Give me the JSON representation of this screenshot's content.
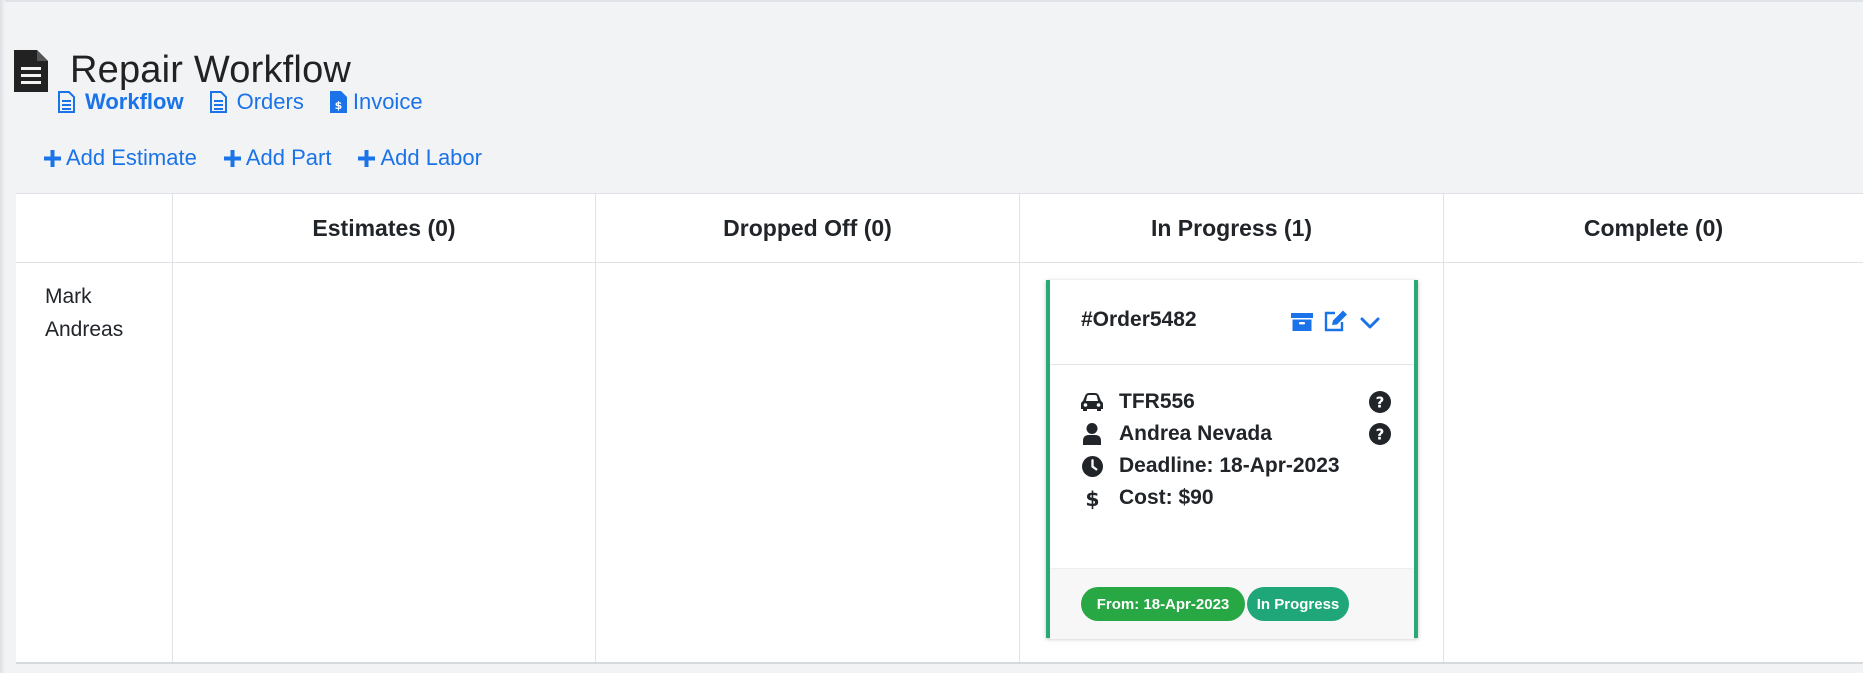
{
  "page": {
    "title": "Repair Workflow",
    "title_icon": "document-icon"
  },
  "nav": {
    "items": [
      {
        "label": "Workflow",
        "icon": "document-icon",
        "active": true
      },
      {
        "label": "Orders",
        "icon": "document-icon",
        "active": false
      },
      {
        "label": "Invoice",
        "icon": "invoice-icon",
        "active": false
      }
    ]
  },
  "actions": [
    {
      "label": "Add Estimate",
      "icon": "plus-icon"
    },
    {
      "label": "Add Part",
      "icon": "plus-icon"
    },
    {
      "label": "Add Labor",
      "icon": "plus-icon"
    }
  ],
  "board": {
    "columns": [
      {
        "label": "Estimates (0)"
      },
      {
        "label": "Dropped Off (0)"
      },
      {
        "label": "In Progress (1)"
      },
      {
        "label": "Complete (0)"
      }
    ],
    "rows": [
      {
        "label": "Mark Andreas"
      }
    ]
  },
  "card": {
    "order_id": "#Order5482",
    "header_icons": [
      "archive-icon",
      "edit-icon",
      "chevron-down-icon"
    ],
    "details": [
      {
        "icon": "car-icon",
        "text": "TFR556",
        "help": true
      },
      {
        "icon": "user-icon",
        "text": "Andrea Nevada",
        "help": true
      },
      {
        "icon": "clock-icon",
        "text": "Deadline: 18-Apr-2023",
        "help": false
      },
      {
        "icon": "dollar-icon",
        "text": "Cost: $90",
        "help": false
      }
    ],
    "badges": [
      {
        "text": "From: 18-Apr-2023"
      },
      {
        "text": "In Progress"
      }
    ]
  },
  "colors": {
    "accent": "#1a73e8",
    "card_border": "#2aa876",
    "badge_from": "#28a745",
    "badge_status": "#20a779",
    "background": "#f2f3f5"
  }
}
